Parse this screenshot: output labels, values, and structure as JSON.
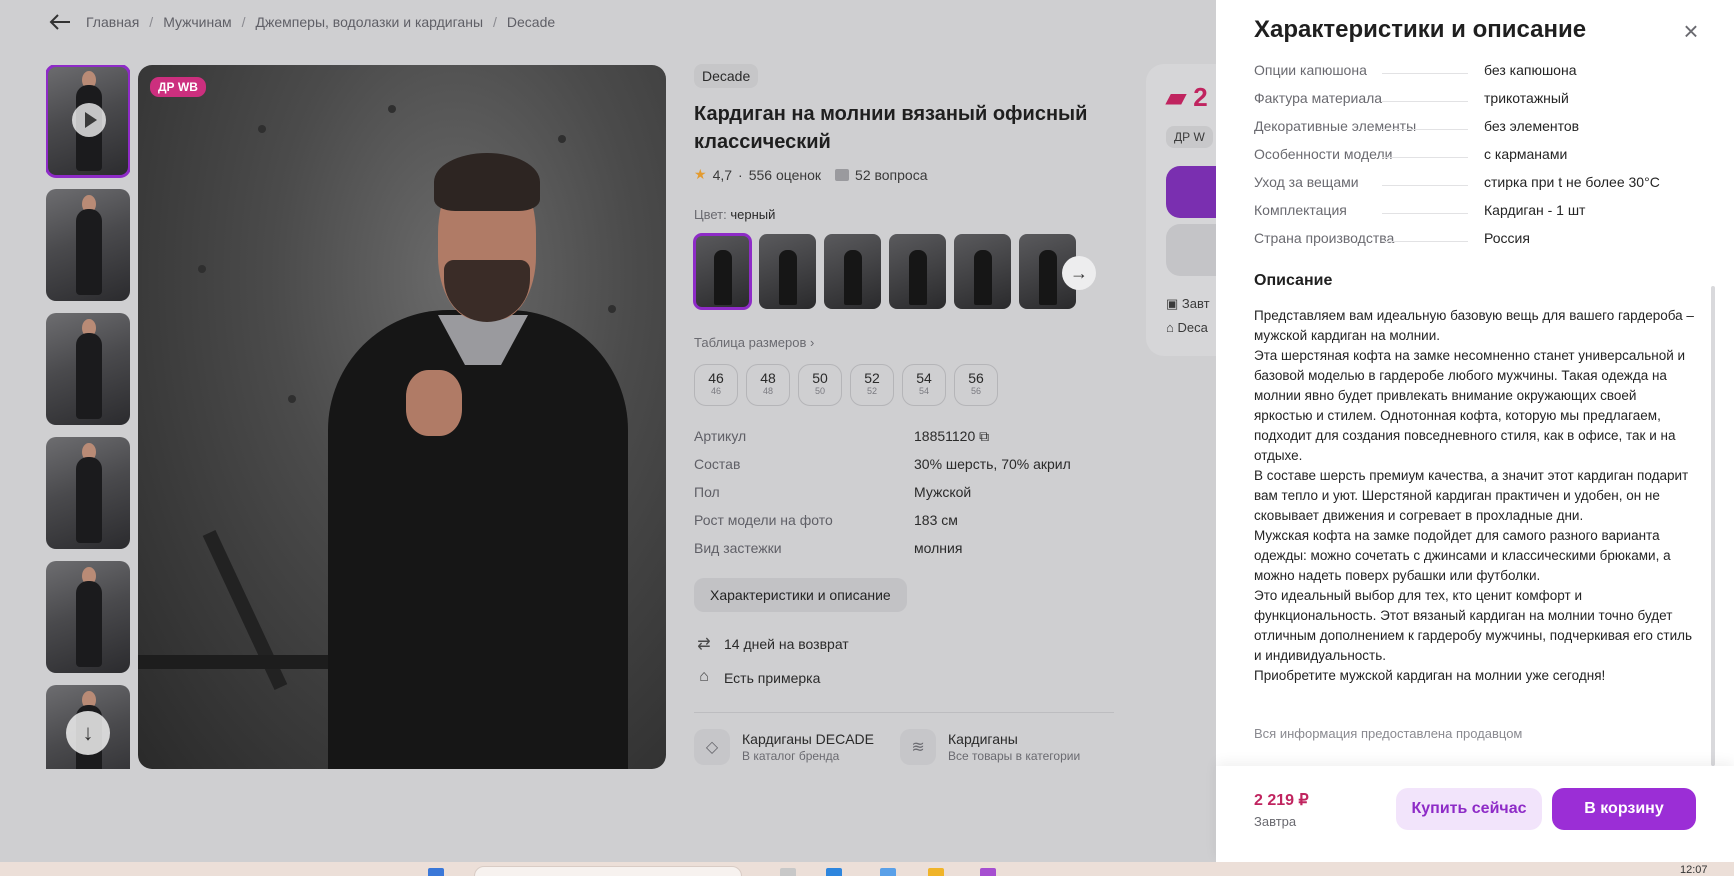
{
  "breadcrumbs": [
    "Главная",
    "Мужчинам",
    "Джемперы, водолазки и кардиганы",
    "Decade"
  ],
  "gallery": {
    "badge": "ДР WB",
    "thumb_count": 6
  },
  "product": {
    "brand": "Decade",
    "title": "Кардиган на молнии вязаный офисный классический",
    "rating": "4,7",
    "reviews": "556 оценок",
    "questions": "52 вопроса",
    "color_label": "Цвет:",
    "color_value": "черный",
    "size_table_link": "Таблица размеров",
    "sizes": [
      {
        "size": "46",
        "ru": "46"
      },
      {
        "size": "48",
        "ru": "48"
      },
      {
        "size": "50",
        "ru": "50"
      },
      {
        "size": "52",
        "ru": "52"
      },
      {
        "size": "54",
        "ru": "54"
      },
      {
        "size": "56",
        "ru": "56"
      }
    ],
    "specs": [
      {
        "k": "Артикул",
        "v": "18851120"
      },
      {
        "k": "Состав",
        "v": "30% шерсть, 70% акрил"
      },
      {
        "k": "Пол",
        "v": "Мужской"
      },
      {
        "k": "Рост модели на фото",
        "v": "183 см"
      },
      {
        "k": "Вид застежки",
        "v": "молния"
      }
    ],
    "char_button": "Характеристики и описание",
    "perks": [
      "14 дней на возврат",
      "Есть примерка"
    ],
    "links": [
      {
        "title": "Кардиганы DECADE",
        "sub": "В каталог бренда"
      },
      {
        "title": "Кардиганы",
        "sub": "Все товары в категории"
      }
    ]
  },
  "buy_card": {
    "price_fragment": "2",
    "dr_fragment": "ДР W",
    "delivery_fragment": "Завт",
    "seller_fragment": "Deca"
  },
  "panel": {
    "title": "Характеристики и описание",
    "specs": [
      {
        "k": "Опции капюшона",
        "v": "без капюшона"
      },
      {
        "k": "Фактура материала",
        "v": "трикотажный"
      },
      {
        "k": "Декоративные элементы",
        "v": "без элементов"
      },
      {
        "k": "Особенности модели",
        "v": "с карманами"
      },
      {
        "k": "Уход за вещами",
        "v": "стирка при t не более 30°C"
      },
      {
        "k": "Комплектация",
        "v": "Кардиган - 1 шт"
      },
      {
        "k": "Страна производства",
        "v": "Россия"
      }
    ],
    "description_heading": "Описание",
    "description_paragraphs": [
      "Представляем вам идеальную базовую вещь для вашего гардероба – мужской кардиган на молнии.",
      "Эта шерстяная кофта на замке несомненно станет универсальной и базовой моделью в гардеробе любого мужчины. Такая одежда на молнии явно будет привлекать внимание окружающих своей яркостью и стилем. Однотонная кофта, которую мы предлагаем, подходит для создания повседневного стиля, как в офисе, так и на отдыхе.",
      "В составе шерсть премиум качества, а значит этот кардиган подарит вам тепло и уют. Шерстяной кардиган практичен и удобен, он не сковывает движения и согревает в прохладные дни.",
      "Мужская кофта на замке подойдет для самого разного варианта одежды: можно сочетать с джинсами и классическими брюками, а можно надеть поверх рубашки или футболки.",
      "Это идеальный выбор для тех, кто ценит комфорт и функциональность. Этот вязаный кардиган на молнии точно будет отличным дополнением к гардеробу мужчины, подчеркивая его стиль и индивидуальность.",
      "Приобретите мужской кардиган на молнии уже сегодня!"
    ],
    "seller_note": "Вся информация предоставлена продавцом",
    "footer": {
      "price": "2 219 ₽",
      "when": "Завтра",
      "buy_now": "Купить сейчас",
      "add_to_cart": "В корзину"
    }
  },
  "taskbar": {
    "clock": "12:07"
  },
  "colors": {
    "accent": "#9b2ed6",
    "price": "#c0245f",
    "badge": "#cc2f7e"
  }
}
